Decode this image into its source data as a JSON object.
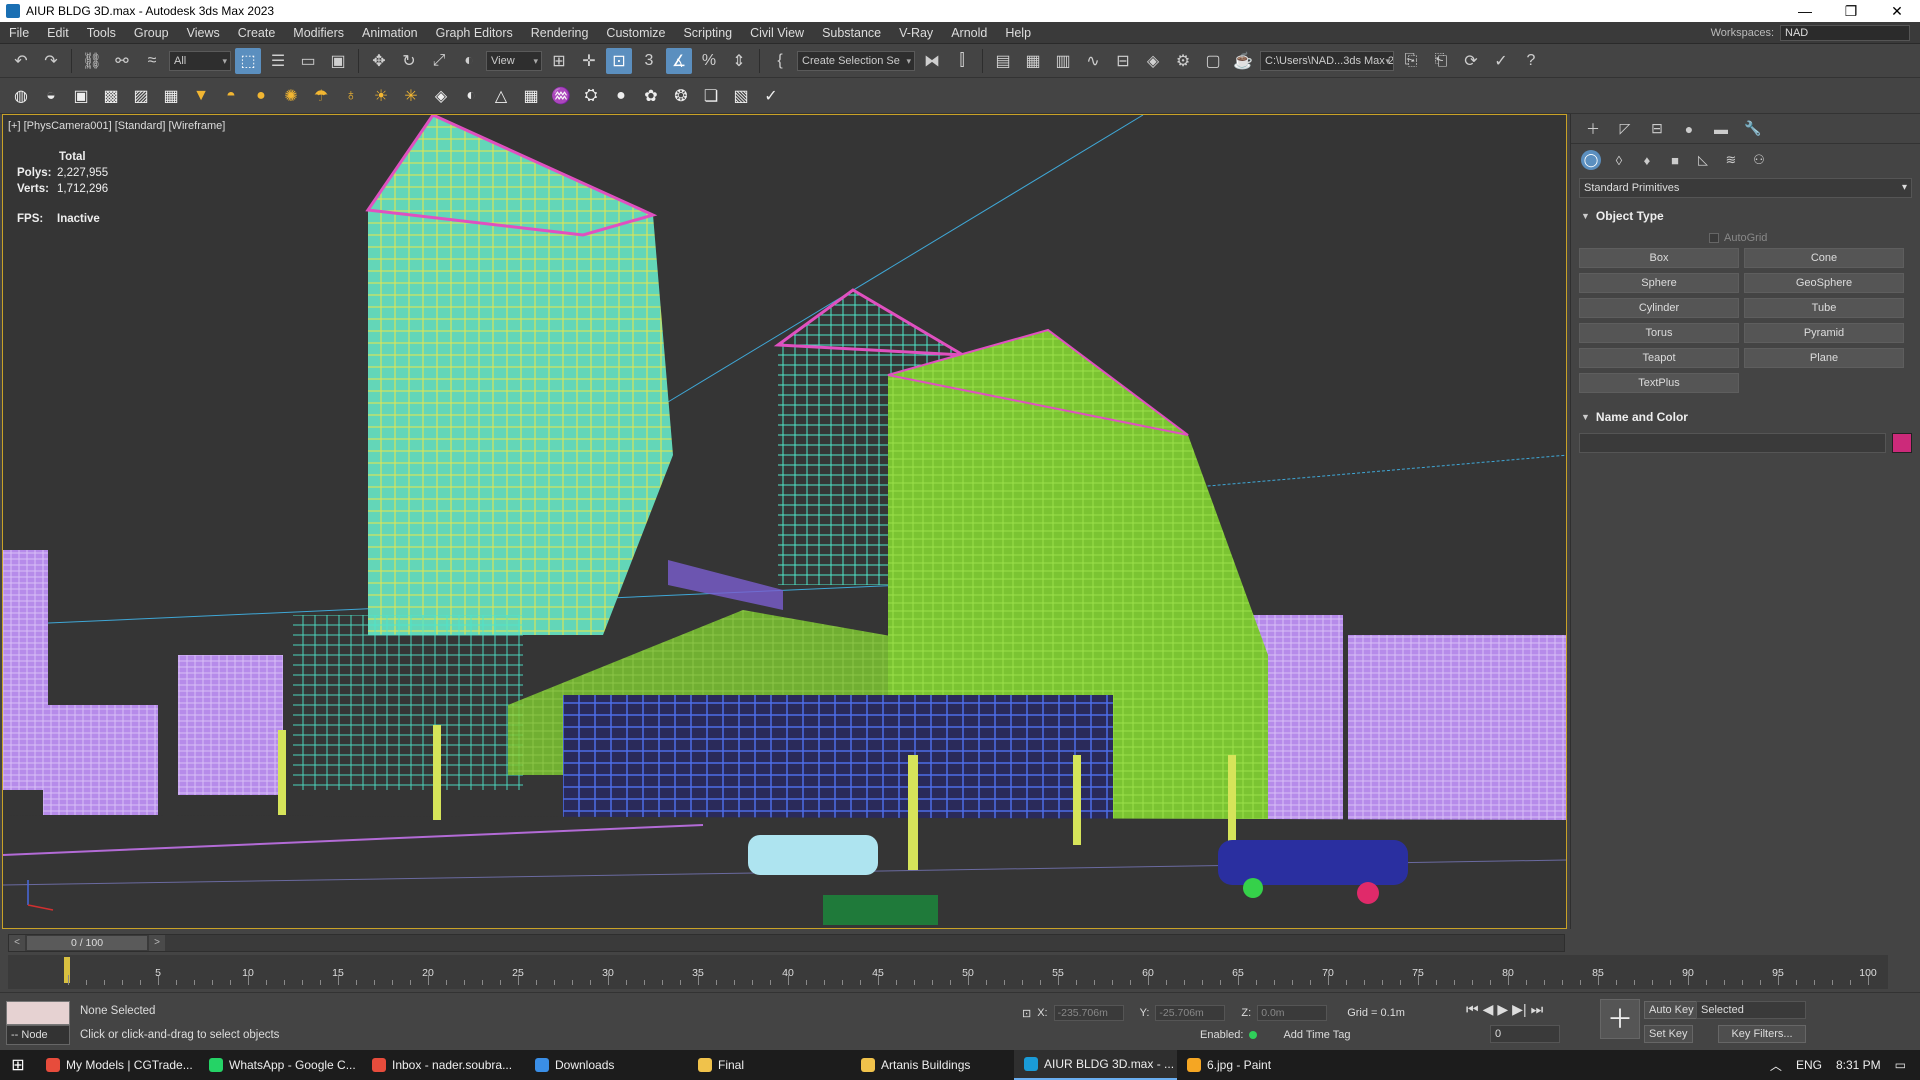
{
  "window": {
    "title": "AIUR BLDG 3D.max - Autodesk 3ds Max 2023",
    "controls": [
      "—",
      "❐",
      "✕"
    ]
  },
  "menu": {
    "items": [
      "File",
      "Edit",
      "Tools",
      "Group",
      "Views",
      "Create",
      "Modifiers",
      "Animation",
      "Graph Editors",
      "Rendering",
      "Customize",
      "Scripting",
      "Civil View",
      "Substance",
      "V-Ray",
      "Arnold",
      "Help"
    ],
    "workspaces_label": "Workspaces:",
    "workspace_value": "NAD"
  },
  "toolbar": {
    "filter_value": "All",
    "view_value": "View",
    "selection_set_value": "Create Selection Se",
    "project_path": "C:\\Users\\NAD...3ds Max 2023"
  },
  "viewport": {
    "label": "[+] [PhysCamera001] [Standard] [Wireframe]",
    "stats_header": "Total",
    "polys_label": "Polys:",
    "polys_value": "2,227,955",
    "verts_label": "Verts:",
    "verts_value": "1,712,296",
    "fps_label": "FPS:",
    "fps_value": "Inactive"
  },
  "command_panel": {
    "category_value": "Standard Primitives",
    "object_type_title": "Object Type",
    "autogrid_label": "AutoGrid",
    "primitives": [
      "Box",
      "Cone",
      "Sphere",
      "GeoSphere",
      "Cylinder",
      "Tube",
      "Torus",
      "Pyramid",
      "Teapot",
      "Plane",
      "TextPlus"
    ],
    "name_color_title": "Name and Color",
    "swatch_color": "#cc2a7a"
  },
  "timeline": {
    "frame_readout": "0 / 100",
    "tick_labels": [
      "5",
      "10",
      "15",
      "20",
      "25",
      "30",
      "35",
      "40",
      "45",
      "50",
      "55",
      "60",
      "65",
      "70",
      "75",
      "80",
      "85",
      "90",
      "95",
      "100"
    ]
  },
  "status": {
    "node_label": "-- Node",
    "selection_status": "None Selected",
    "prompt": "Click or click-and-drag to select objects",
    "x_label": "X:",
    "x_value": "-235.706m",
    "y_label": "Y:",
    "y_value": "-25.706m",
    "z_label": "Z:",
    "z_value": "0.0m",
    "grid": "Grid = 0.1m",
    "enabled_label": "Enabled:",
    "add_time_tag": "Add Time Tag",
    "current_frame": "0",
    "auto_key": "Auto Key",
    "set_key": "Set Key",
    "selected_value": "Selected",
    "key_filters": "Key Filters..."
  },
  "taskbar": {
    "items": [
      {
        "label": "My Models | CGTrade...",
        "color": "#e74c3c"
      },
      {
        "label": "WhatsApp - Google C...",
        "color": "#25d366"
      },
      {
        "label": "Inbox - nader.soubra...",
        "color": "#e74c3c"
      },
      {
        "label": "Downloads",
        "color": "#3a8ee6"
      },
      {
        "label": "Final",
        "color": "#f0c24b"
      },
      {
        "label": "Artanis Buildings",
        "color": "#f0c24b"
      },
      {
        "label": "AIUR BLDG 3D.max - ...",
        "color": "#1a9bd7"
      },
      {
        "label": "6.jpg - Paint",
        "color": "#f5a623"
      }
    ],
    "lang": "ENG",
    "time": "8:31 PM"
  }
}
